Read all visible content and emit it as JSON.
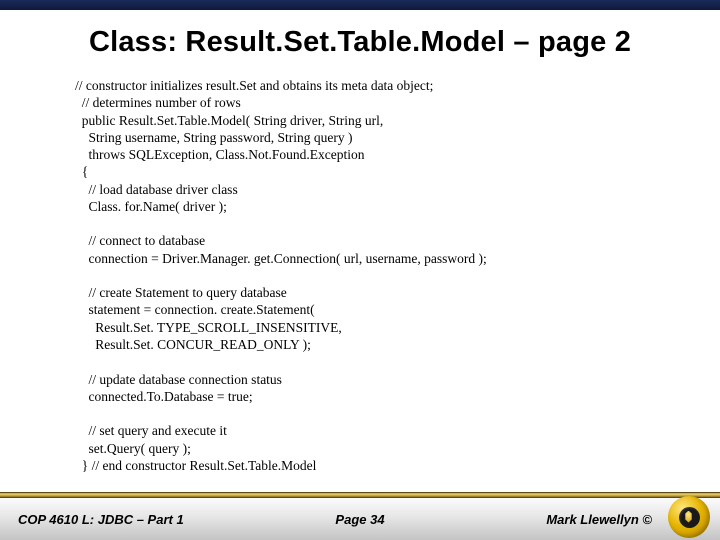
{
  "title": "Class:  Result.Set.Table.Model – page 2",
  "code": "// constructor initializes result.Set and obtains its meta data object;\n  // determines number of rows\n  public Result.Set.Table.Model( String driver, String url,\n    String username, String password, String query )\n    throws SQLException, Class.Not.Found.Exception\n  {\n    // load database driver class\n    Class. for.Name( driver );\n\n    // connect to database\n    connection = Driver.Manager. get.Connection( url, username, password );\n\n    // create Statement to query database\n    statement = connection. create.Statement(\n      Result.Set. TYPE_SCROLL_INSENSITIVE,\n      Result.Set. CONCUR_READ_ONLY );\n\n    // update database connection status\n    connected.To.Database = true;\n\n    // set query and execute it\n    set.Query( query );\n  } // end constructor Result.Set.Table.Model",
  "footer": {
    "left": "COP 4610 L: JDBC – Part 1",
    "center": "Page 34",
    "right": "Mark Llewellyn ©"
  }
}
